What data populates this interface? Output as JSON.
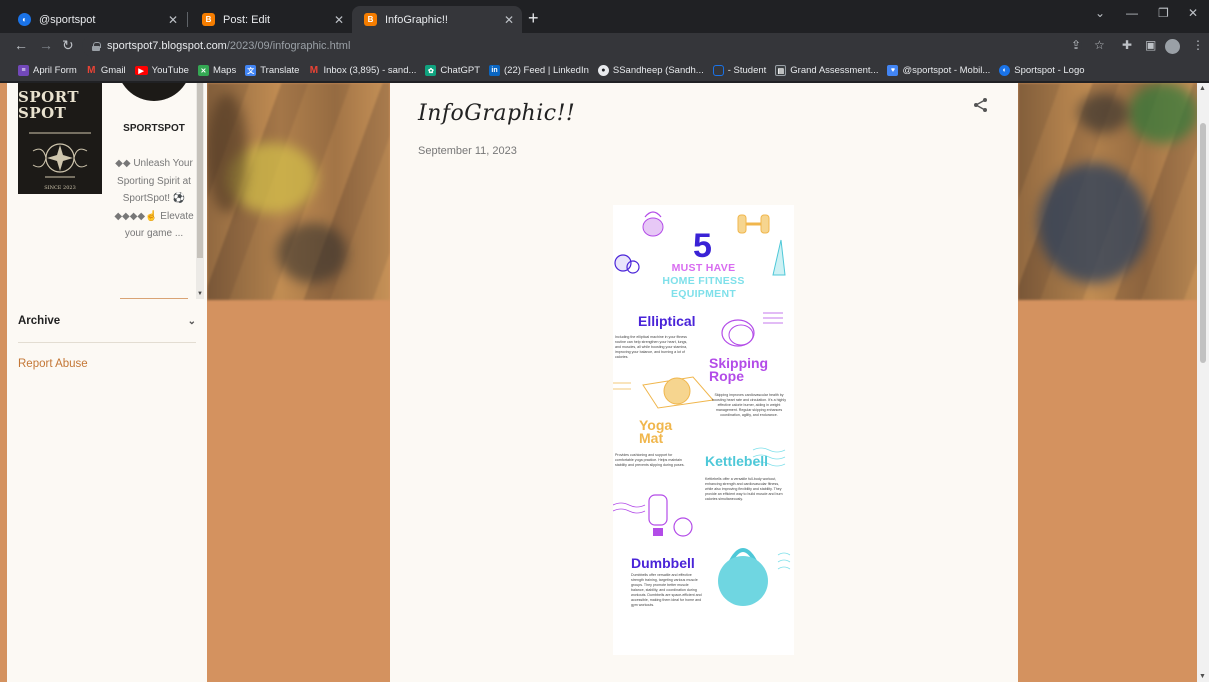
{
  "browser": {
    "tabs": [
      {
        "title": "@sportspot",
        "icon": "blogger-profile-icon",
        "color": "#1a73e8",
        "active": false
      },
      {
        "title": "Post: Edit",
        "icon": "blogger-icon",
        "color": "#f57d00",
        "active": false
      },
      {
        "title": "InfoGraphic!!",
        "icon": "blogger-icon",
        "color": "#f57d00",
        "active": true
      }
    ],
    "new_tab_label": "+",
    "url_host": "sportspot7.blogspot.com",
    "url_path": "/2023/09/infographic.html",
    "bookmarks": [
      {
        "label": "April Form",
        "icon": "forms-icon",
        "color": "#7248b9"
      },
      {
        "label": "Gmail",
        "icon": "gmail-icon",
        "color": "#ea4335"
      },
      {
        "label": "YouTube",
        "icon": "youtube-icon",
        "color": "#ff0000"
      },
      {
        "label": "Maps",
        "icon": "maps-icon",
        "color": "#34a853"
      },
      {
        "label": "Translate",
        "icon": "translate-icon",
        "color": "#4285f4"
      },
      {
        "label": "Inbox (3,895) - sand...",
        "icon": "gmail-icon",
        "color": "#ea4335"
      },
      {
        "label": "ChatGPT",
        "icon": "chatgpt-icon",
        "color": "#10a37f"
      },
      {
        "label": "(22) Feed | LinkedIn",
        "icon": "linkedin-icon",
        "color": "#0a66c2"
      },
      {
        "label": "SSandheep (Sandh...",
        "icon": "github-icon",
        "color": "#e8eaed"
      },
      {
        "label": "- Student",
        "icon": "student-icon",
        "color": "#1a73e8"
      },
      {
        "label": "Grand Assessment...",
        "icon": "assessment-icon",
        "color": "#3c4043"
      },
      {
        "label": "@sportspot - Mobil...",
        "icon": "mobile-icon",
        "color": "#4285f4"
      },
      {
        "label": "Sportspot - Logo",
        "icon": "logo-icon",
        "color": "#1a73e8"
      }
    ]
  },
  "sidebar": {
    "logo_text_1": "SPORT SPOT",
    "logo_text_2": "SINCE 2023",
    "blog_name": "SPORTSPOT",
    "description": "◆◆ Unleash Your Sporting Spirit at SportSpot! ⚽ ◆◆◆◆☝ Elevate your game ...",
    "archive_label": "Archive",
    "report_label": "Report Abuse"
  },
  "post": {
    "title": "InfoGraphic!!",
    "date": "September 11, 2023"
  },
  "infographic": {
    "number": "5",
    "heading_1": "MUST HAVE",
    "heading_2": "HOME FITNESS",
    "heading_3": "EQUIPMENT",
    "items": [
      {
        "title": "Elliptical",
        "body": "Including the elliptical machine in your fitness routine can help strengthen your heart, lungs, and muscles, all while boosting your stamina, improving your balance, and burning a lot of calories."
      },
      {
        "title": "Skipping Rope",
        "body": "Skipping improves cardiovascular health by boosting heart rate and circulation. It's a highly effective calorie burner, aiding in weight management. Regular skipping enhances coordination, agility, and endurance."
      },
      {
        "title": "Yoga Mat",
        "body": "Provides cushioning and support for comfortable yoga practice. Helps maintain stability and prevents slipping during poses."
      },
      {
        "title": "Kettlebell",
        "body": "Kettlebells offer a versatile full-body workout, enhancing strength and cardiovascular fitness, while also improving flexibility and stability. They provide an efficient way to build muscle and burn calories simultaneously."
      },
      {
        "title": "Dumbbell",
        "body": "Dumbbells offer versatile and effective strength training, targeting various muscle groups. They promote better muscle balance, stability, and coordination during workouts. Dumbbells are space-efficient and accessible, making them ideal for home and gym workouts."
      }
    ]
  },
  "colors": {
    "page_bg": "#d4925f",
    "content_bg": "#fcf9f4",
    "link": "#c47736",
    "ig_purple": "#4a24d8",
    "ig_violet": "#b34ce8",
    "ig_yellow": "#f0b64c",
    "ig_teal": "#4ec8d8"
  }
}
